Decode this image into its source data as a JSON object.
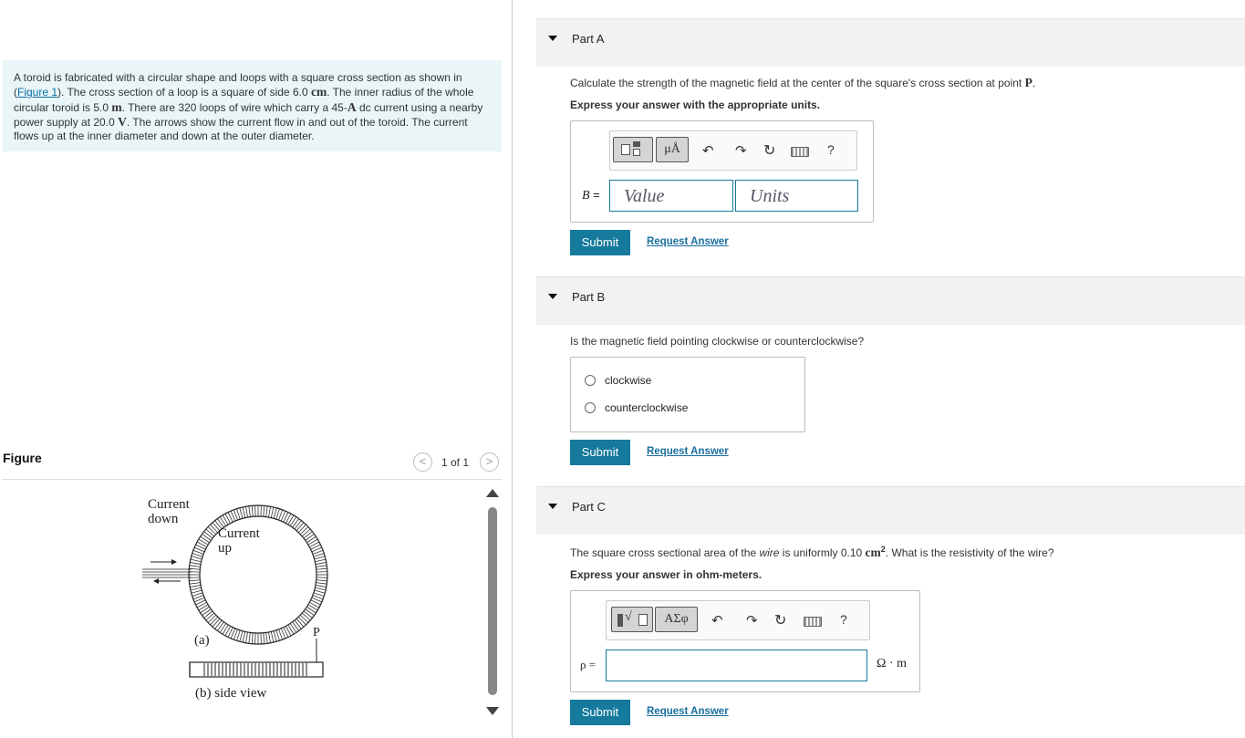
{
  "problem": {
    "text_1": "A toroid is fabricated with a circular shape and loops with a square cross section as shown in (",
    "figure_link": "Figure 1",
    "text_2": "). The cross section of a loop is a square of side 6.0 ",
    "unit_cm": "cm",
    "text_3": ". The inner radius of the whole circular toroid is 5.0 ",
    "unit_m": "m",
    "text_4": ". There are 320 loops of wire which carry a 45-",
    "unit_A": "A",
    "text_5": " dc current using a nearby power supply at 20.0 ",
    "unit_V": "V",
    "text_6": ". The arrows show the current flow in and out of the toroid. The current flows up at the inner diameter and down at the outer diameter."
  },
  "figure": {
    "label": "Figure",
    "prev_icon": "chevron-left-icon",
    "next_icon": "chevron-right-icon",
    "pager": "1 of 1",
    "labels": {
      "current_down_1": "Current",
      "current_down_2": "down",
      "current_up_1": "Current",
      "current_up_2": "up",
      "point_p": "P",
      "a": "(a)",
      "b": "(b) side view"
    }
  },
  "part_a": {
    "title": "Part A",
    "prompt": "Calculate the strength of the magnetic field at the center of the square's cross section at point ",
    "prompt_point": "P",
    "prompt_end": ".",
    "instruction": "Express your answer with the appropriate units.",
    "toolbar": {
      "units_button": "μÅ",
      "icons": [
        "templates-icon",
        "undo-icon",
        "redo-icon",
        "reset-icon",
        "keyboard-icon",
        "help-icon"
      ],
      "help": "?"
    },
    "var_label": "B =",
    "value_placeholder": "Value",
    "units_placeholder": "Units",
    "submit": "Submit",
    "request": "Request Answer"
  },
  "part_b": {
    "title": "Part B",
    "prompt": "Is the magnetic field pointing clockwise or counterclockwise?",
    "options": [
      "clockwise",
      "counterclockwise"
    ],
    "submit": "Submit",
    "request": "Request Answer"
  },
  "part_c": {
    "title": "Part C",
    "prompt_1": "The square cross sectional area of the ",
    "prompt_wire": "wire",
    "prompt_2": " is uniformly 0.10 ",
    "prompt_unit": "cm",
    "prompt_sup": "2",
    "prompt_3": ". What is the resistivity of the wire?",
    "instruction": "Express your answer in ohm-meters.",
    "toolbar": {
      "greek_button": "ΑΣφ",
      "icons": [
        "math-templates-icon",
        "undo-icon",
        "redo-icon",
        "reset-icon",
        "keyboard-icon",
        "help-icon"
      ],
      "help": "?"
    },
    "var_label": "ρ =",
    "unit_label": "Ω · m",
    "submit": "Submit",
    "request": "Request Answer"
  },
  "colors": {
    "accent": "#157a9b",
    "link": "#1a6fa0",
    "problem_bg": "#e9f5f7"
  }
}
